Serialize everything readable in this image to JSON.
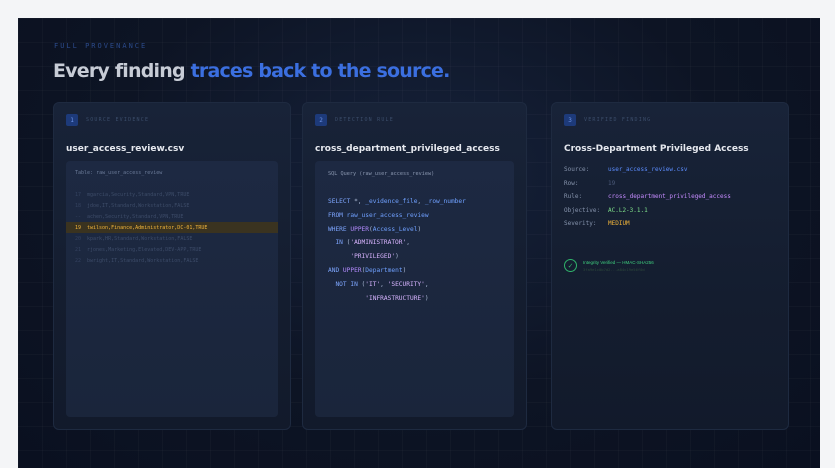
{
  "eyebrow": "FULL PROVENANCE",
  "headline": {
    "lead": "Every finding ",
    "accent": "traces back to the source."
  },
  "cards": [
    {
      "step": "1",
      "label": "SOURCE EVIDENCE",
      "title": "user_access_review.csv",
      "table_caption": "Table: raw_user_access_review",
      "rows": [
        {
          "n": "17",
          "text": "mgarcia,Security,Standard,VPN,TRUE",
          "highlight": false
        },
        {
          "n": "18",
          "text": "jdoe,IT,Standard,Workstation,FALSE",
          "highlight": false
        },
        {
          "n": "--",
          "text": "achen,Security,Standard,VPN,TRUE",
          "highlight": false
        },
        {
          "n": "19",
          "text": "twilson,Finance,Administrator,DC-01,TRUE",
          "highlight": true
        },
        {
          "n": "20",
          "text": "kpark,HR,Standard,Workstation,FALSE",
          "highlight": false
        },
        {
          "n": "21",
          "text": "rjones,Marketing,Elevated,DEV-APP,TRUE",
          "highlight": false
        },
        {
          "n": "22",
          "text": "bwright,IT,Standard,Workstation,FALSE",
          "highlight": false
        }
      ]
    },
    {
      "step": "2",
      "label": "DETECTION RULE",
      "title": "cross_department_privileged_access",
      "sql_caption": "SQL Query (raw_user_access_review)"
    },
    {
      "step": "3",
      "label": "VERIFIED FINDING",
      "title": "Cross-Department Privileged Access",
      "fields": [
        {
          "key": "Source:",
          "value": "user_access_review.csv"
        },
        {
          "key": "Row:",
          "value": "19"
        },
        {
          "key": "Rule:",
          "value": "cross_department_privileged_access"
        },
        {
          "key": "Objective:",
          "value": "AC.L2-3.1.1"
        },
        {
          "key": "Severity:",
          "value": "MEDIUM"
        }
      ],
      "integrity": "Integrity Verified — HMAC-SHA256",
      "integrity_sub": "3fa9e1c0b7d2...a84c19e56f0d"
    }
  ],
  "colors": {
    "accent": "#3b6fe0",
    "highlight": "#f2b53a",
    "verified": "#3fcf7e"
  }
}
